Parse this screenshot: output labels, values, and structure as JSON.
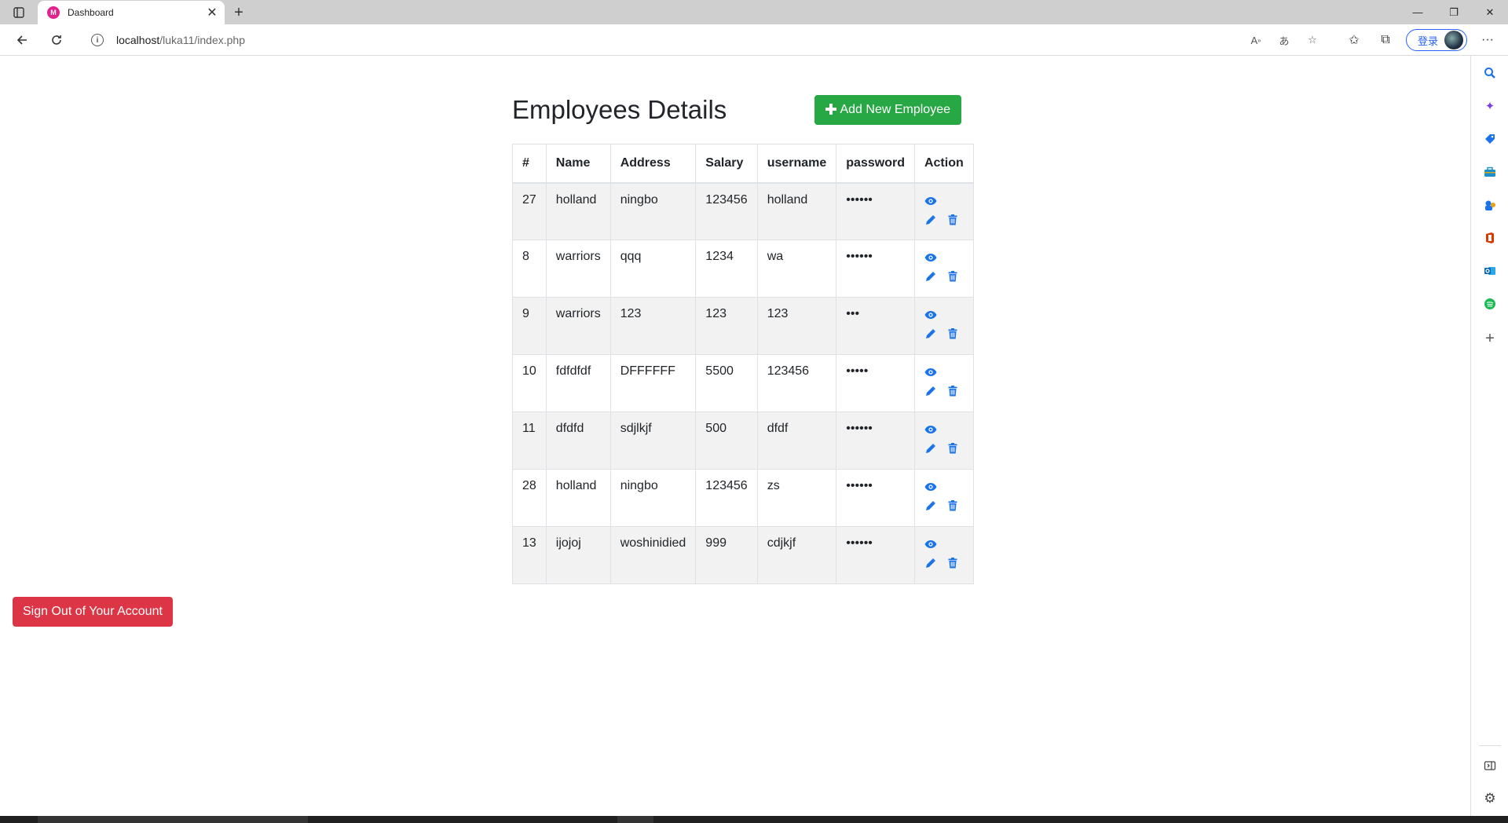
{
  "browser": {
    "tab_title": "Dashboard",
    "tab_favicon_text": "M",
    "url_host": "localhost",
    "url_path": "/luka11/index.php",
    "login_label": "登录"
  },
  "page": {
    "title": "Employees Details",
    "add_button_label": "Add New Employee",
    "signout_label": "Sign Out of Your Account"
  },
  "table": {
    "headers": [
      "#",
      "Name",
      "Address",
      "Salary",
      "username",
      "password",
      "Action"
    ],
    "rows": [
      {
        "id": "27",
        "name": "holland",
        "address": "ningbo",
        "salary": "123456",
        "username": "holland",
        "password": "••••••"
      },
      {
        "id": "8",
        "name": "warriors",
        "address": "qqq",
        "salary": "1234",
        "username": "wa",
        "password": "••••••"
      },
      {
        "id": "9",
        "name": "warriors",
        "address": "123",
        "salary": "123",
        "username": "123",
        "password": "•••"
      },
      {
        "id": "10",
        "name": "fdfdfdf",
        "address": "DFFFFFF",
        "salary": "5500",
        "username": "123456",
        "password": "•••••"
      },
      {
        "id": "11",
        "name": "dfdfd",
        "address": "sdjlkjf",
        "salary": "500",
        "username": "dfdf",
        "password": "••••••"
      },
      {
        "id": "28",
        "name": "holland",
        "address": "ningbo",
        "salary": "123456",
        "username": "zs",
        "password": "••••••"
      },
      {
        "id": "13",
        "name": "ijojoj",
        "address": "woshinidied",
        "salary": "999",
        "username": "cdjkjf",
        "password": "••••••"
      }
    ]
  },
  "colors": {
    "add_button": "#28a745",
    "signout_button": "#dc3545",
    "action_icon": "#1a73e8"
  },
  "icons": {
    "view": "eye-icon",
    "edit": "pencil-icon",
    "delete": "trash-icon"
  }
}
